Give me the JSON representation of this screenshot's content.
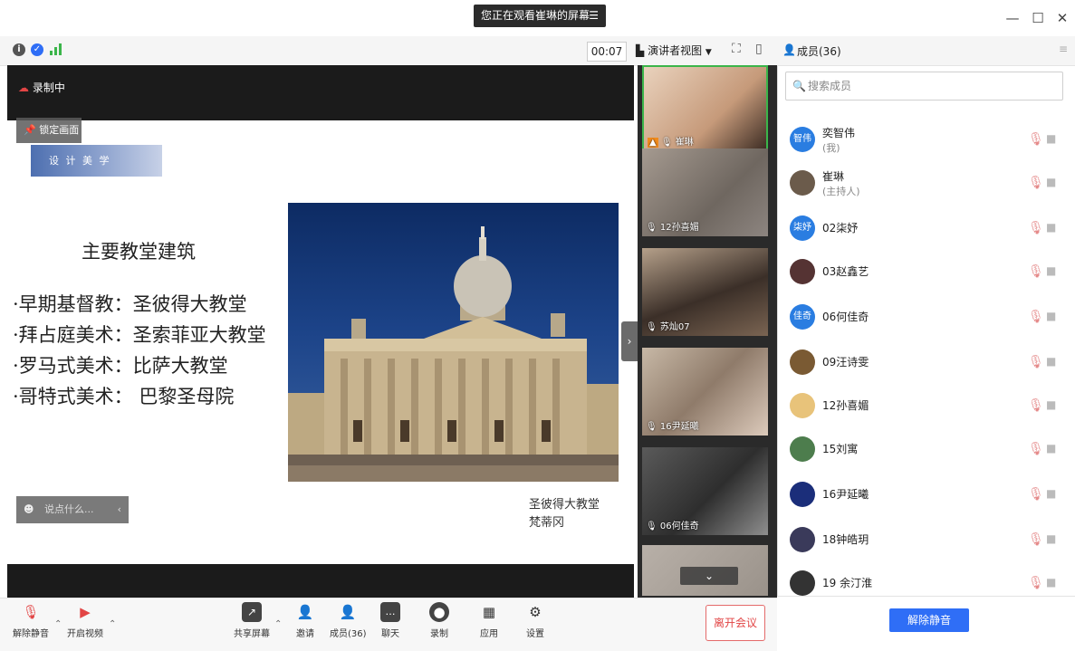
{
  "window": {
    "screen_notice": "您正在观看崔琳的屏幕",
    "controls": {
      "minimize": "—",
      "maximize": "☐",
      "close": "✕"
    }
  },
  "toolbar": {
    "timer": "00:07",
    "view_label": "演讲者视图",
    "members_title": "成员(36)"
  },
  "stage": {
    "recording": "录制中",
    "lock_view": "锁定画面",
    "banner_text": "设 计 美 学",
    "slide_heading": "主要教堂建筑",
    "bullets": [
      "·早期基督教：圣彼得大教堂",
      "·拜占庭美术：圣索菲亚大教堂",
      "·罗马式美术：比萨大教堂",
      "·哥特式美术： 巴黎圣母院"
    ],
    "photo_caption_1": "圣彼得大教堂",
    "photo_caption_2": "梵蒂冈",
    "chat_placeholder": "说点什么..."
  },
  "video_tiles": [
    {
      "name": "崔琳"
    },
    {
      "name": "12孙喜媚"
    },
    {
      "name": "苏灿07"
    },
    {
      "name": "16尹延曦"
    },
    {
      "name": "06何佳奇"
    },
    {
      "name": ""
    }
  ],
  "members_panel": {
    "search_placeholder": "搜索成员",
    "members": [
      {
        "avatar_text": "智伟",
        "name": "奕智伟",
        "role": "(我)",
        "color": "#2a7de1"
      },
      {
        "avatar_text": "",
        "name": "崔琳",
        "role": "(主持人)",
        "color": "#6b5b4b"
      },
      {
        "avatar_text": "柒妤",
        "name": "02柒妤",
        "role": "",
        "color": "#2a7de1"
      },
      {
        "avatar_text": "",
        "name": "03赵鑫艺",
        "role": "",
        "color": "#553333"
      },
      {
        "avatar_text": "佳奇",
        "name": "06何佳奇",
        "role": "",
        "color": "#2a7de1"
      },
      {
        "avatar_text": "",
        "name": "09汪诗雯",
        "role": "",
        "color": "#7a5a33"
      },
      {
        "avatar_text": "",
        "name": "12孙喜媚",
        "role": "",
        "color": "#e8c37a"
      },
      {
        "avatar_text": "",
        "name": "15刘寓",
        "role": "",
        "color": "#4d7d4d"
      },
      {
        "avatar_text": "",
        "name": "16尹延曦",
        "role": "",
        "color": "#1b2e7a"
      },
      {
        "avatar_text": "",
        "name": "18钟皓玥",
        "role": "",
        "color": "#3a3a5a"
      },
      {
        "avatar_text": "",
        "name": "19 余汀淮",
        "role": "",
        "color": "#333333"
      }
    ],
    "unmute_all": "解除静音"
  },
  "bottom_bar": {
    "unmute": "解除静音",
    "start_video": "开启视频",
    "share_screen": "共享屏幕",
    "invite": "邀请",
    "members": "成员(36)",
    "chat": "聊天",
    "record": "录制",
    "apps": "应用",
    "settings": "设置",
    "leave": "离开会议"
  },
  "colors": {
    "accent": "#2f6ef6",
    "leave": "#e24545",
    "stage_bg": "#1b1b1b"
  }
}
